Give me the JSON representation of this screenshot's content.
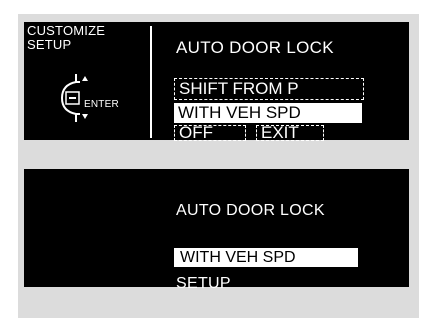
{
  "screen1": {
    "menu_label": "CUSTOMIZE SETUP",
    "enter_label": "ENTER",
    "title": "AUTO DOOR LOCK",
    "options": [
      {
        "label": "SHIFT FROM P",
        "state": "unselected"
      },
      {
        "label": "WITH VEH SPD",
        "state": "selected"
      },
      {
        "label": "OFF",
        "state": "unselected"
      },
      {
        "label": "EXIT",
        "state": "unselected"
      }
    ]
  },
  "screen2": {
    "title": "AUTO DOOR LOCK",
    "selected_value": "WITH VEH SPD",
    "footer": "SETUP"
  },
  "icons": {
    "dial": "selector-knob-icon",
    "up_arrow": "arrow-up-icon",
    "down_arrow": "arrow-down-icon"
  },
  "colors": {
    "background": "#dcdcdc",
    "screen": "#000000",
    "text": "#ffffff",
    "highlight": "#ffffff"
  }
}
